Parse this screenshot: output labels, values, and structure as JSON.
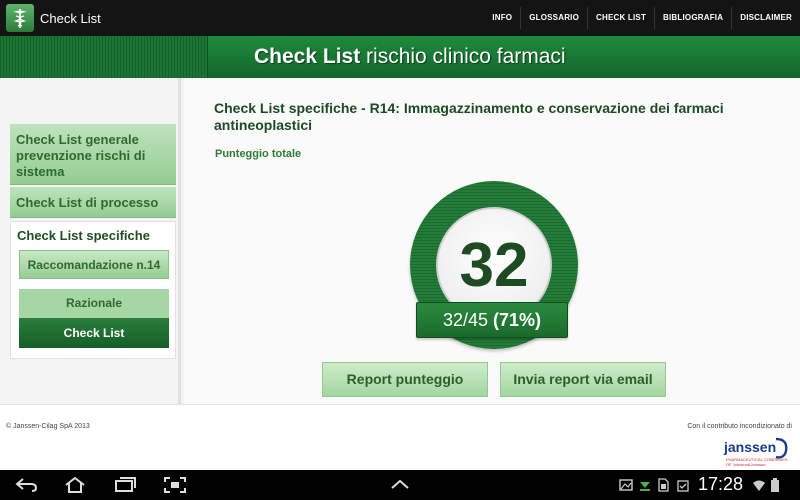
{
  "app": {
    "title": "Check List"
  },
  "menu": [
    "INFO",
    "GLOSSARIO",
    "CHECK LIST",
    "BIBLIOGRAFIA",
    "DISCLAIMER"
  ],
  "banner": {
    "bold": "Check List",
    "rest": " rischio clinico farmaci"
  },
  "sidebar": {
    "general": "Check List generale prevenzione rischi di sistema",
    "process": "Check List di processo",
    "specific_title": "Check List specifiche",
    "recommendation": "Raccomandazione n.14",
    "rationale": "Razionale",
    "checklist": "Check List"
  },
  "main": {
    "title": "Check List specifiche - R14: Immagazzinamento e conservazione dei farmaci antineoplastici",
    "score_label": "Punteggio totale",
    "score": "32",
    "score_fraction": "32/45",
    "score_percent": "(71%)",
    "btn_report": "Report punteggio",
    "btn_email": "Invia report via email"
  },
  "footer": {
    "copyright": "© Janssen-Cilag SpA 2013",
    "contrib": "Con il contributo incondizionato di",
    "logo": "janssen",
    "logo_sub": "PHARMACEUTICAL COMPANIES OF Johnson&Johnson"
  },
  "system": {
    "clock": "17:28"
  },
  "colors": {
    "brand_green": "#1b7634",
    "light_green": "#a6d6a3",
    "dark_text": "#1e4a23"
  }
}
